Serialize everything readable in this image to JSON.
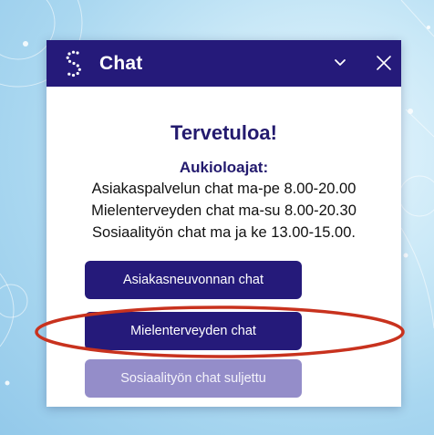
{
  "chat": {
    "title": "Chat",
    "welcome": "Tervetuloa!",
    "hours_title": "Aukioloajat:",
    "hours": [
      "Asiakaspalvelun chat ma-pe 8.00-20.00",
      "Mielenterveyden chat ma-su 8.00-20.30",
      "Sosiaalityön chat ma ja ke 13.00-15.00."
    ],
    "buttons": [
      {
        "label": "Asiakasneuvonnan chat",
        "state": "enabled"
      },
      {
        "label": "Mielenterveyden chat",
        "state": "enabled",
        "highlighted": true
      },
      {
        "label": "Sosiaalityön chat suljettu",
        "state": "disabled"
      }
    ]
  },
  "icons": {
    "logo": "dotted-s-logo",
    "minimize": "chevron-down-icon",
    "close": "close-icon"
  },
  "colors": {
    "header": "#251a7a",
    "button": "#251a7a",
    "button_disabled": "#948dc9",
    "highlight": "#c8321e",
    "heading": "#231a6e"
  }
}
